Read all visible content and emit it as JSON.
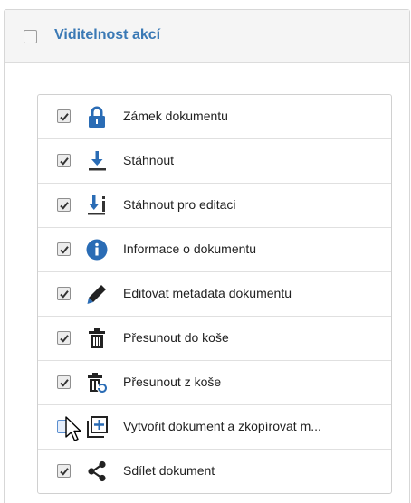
{
  "header": {
    "title": "Viditelnost akcí",
    "checked": false
  },
  "colors": {
    "accent": "#3a79b5",
    "icon": "#2a6cb5",
    "text": "#222222"
  },
  "actions": [
    {
      "label": "Zámek dokumentu",
      "icon": "lock-icon",
      "checked": true
    },
    {
      "label": "Stáhnout",
      "icon": "download-icon",
      "checked": true
    },
    {
      "label": "Stáhnout pro editaci",
      "icon": "download-edit-icon",
      "checked": true
    },
    {
      "label": "Informace o dokumentu",
      "icon": "info-icon",
      "checked": true
    },
    {
      "label": "Editovat metadata dokumentu",
      "icon": "pencil-icon",
      "checked": true
    },
    {
      "label": "Přesunout do koše",
      "icon": "trash-icon",
      "checked": true
    },
    {
      "label": "Přesunout z koše",
      "icon": "trash-restore-icon",
      "checked": true
    },
    {
      "label": "Vytvořit dokument a zkopírovat m...",
      "icon": "copy-plus-icon",
      "checked": false
    },
    {
      "label": "Sdílet dokument",
      "icon": "share-icon",
      "checked": true
    }
  ]
}
